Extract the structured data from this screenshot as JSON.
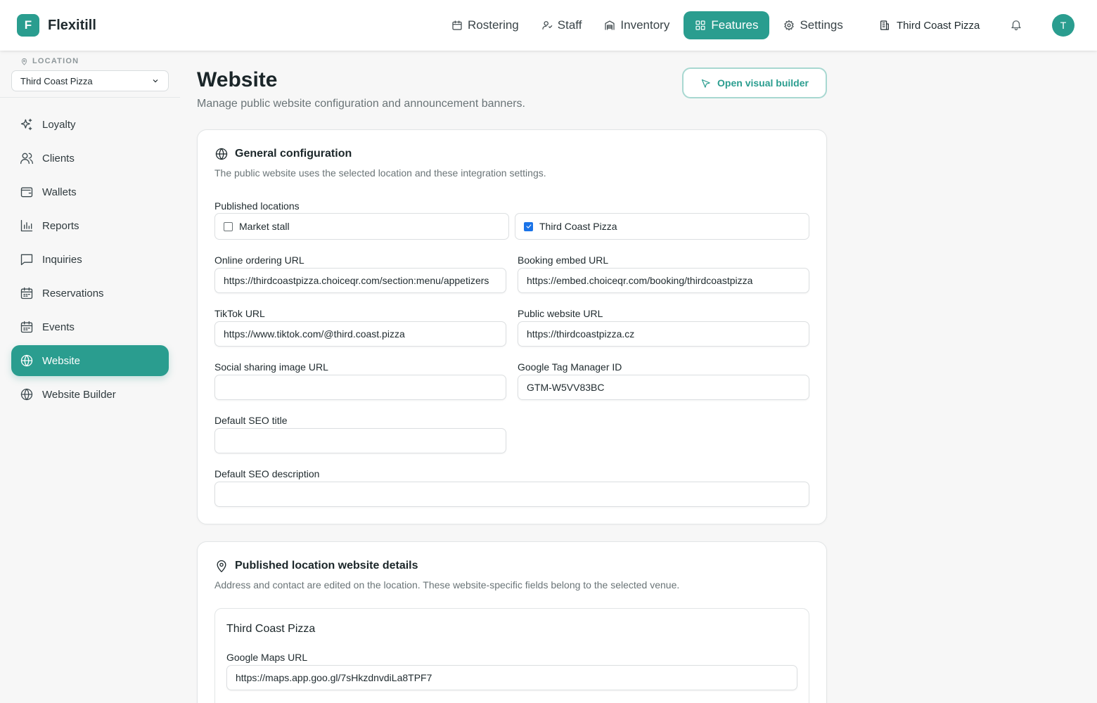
{
  "brand": {
    "logo_letter": "F",
    "name": "Flexitill"
  },
  "nav": {
    "items": [
      {
        "label": "Rostering",
        "icon": "calendar-icon"
      },
      {
        "label": "Staff",
        "icon": "staff-icon"
      },
      {
        "label": "Inventory",
        "icon": "inventory-icon"
      },
      {
        "label": "Features",
        "icon": "grid-icon",
        "active": true
      },
      {
        "label": "Settings",
        "icon": "gear-icon"
      }
    ],
    "location_switcher": "Third Coast Pizza",
    "avatar_letter": "T"
  },
  "sidebar": {
    "location_label": "LOCATION",
    "location_value": "Third Coast Pizza",
    "items": [
      {
        "label": "Loyalty",
        "icon": "sparkles-icon"
      },
      {
        "label": "Clients",
        "icon": "users-icon"
      },
      {
        "label": "Wallets",
        "icon": "wallet-icon"
      },
      {
        "label": "Reports",
        "icon": "bar-chart-icon"
      },
      {
        "label": "Inquiries",
        "icon": "message-icon"
      },
      {
        "label": "Reservations",
        "icon": "calendar-icon"
      },
      {
        "label": "Events",
        "icon": "calendar-icon"
      },
      {
        "label": "Website",
        "icon": "globe-icon",
        "active": true
      },
      {
        "label": "Website Builder",
        "icon": "globe-icon"
      }
    ]
  },
  "page": {
    "title": "Website",
    "subtitle": "Manage public website configuration and announcement banners.",
    "builder_button": "Open visual builder"
  },
  "general": {
    "title": "General configuration",
    "description": "The public website uses the selected location and these integration settings.",
    "published_label": "Published locations",
    "locations": [
      {
        "label": "Market stall",
        "checked": false
      },
      {
        "label": "Third Coast Pizza",
        "checked": true
      }
    ],
    "online_ordering_label": "Online ordering URL",
    "online_ordering_value": "https://thirdcoastpizza.choiceqr.com/section:menu/appetizers",
    "booking_label": "Booking embed URL",
    "booking_value": "https://embed.choiceqr.com/booking/thirdcoastpizza",
    "tiktok_label": "TikTok URL",
    "tiktok_value": "https://www.tiktok.com/@third.coast.pizza",
    "public_url_label": "Public website URL",
    "public_url_value": "https://thirdcoastpizza.cz",
    "social_image_label": "Social sharing image URL",
    "social_image_value": "",
    "gtm_label": "Google Tag Manager ID",
    "gtm_value": "GTM-W5VV83BC",
    "seo_title_label": "Default SEO title",
    "seo_title_value": "",
    "seo_desc_label": "Default SEO description",
    "seo_desc_value": ""
  },
  "published": {
    "title": "Published location website details",
    "description": "Address and contact are edited on the location. These website-specific fields belong to the selected venue.",
    "venue_name": "Third Coast Pizza",
    "maps_label": "Google Maps URL",
    "maps_value": "https://maps.app.goo.gl/7sHkzdnvdiLa8TPF7"
  },
  "colors": {
    "accent": "#2a9d8f",
    "checkbox": "#1a73e8",
    "background": "#f7f7f7"
  }
}
